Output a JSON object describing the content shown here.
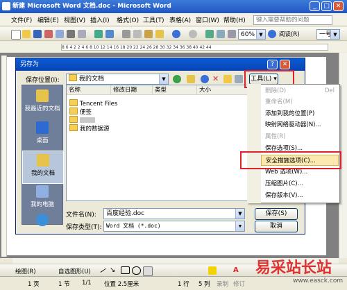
{
  "window": {
    "title": "新建 Microsoft Word 文档.doc - Microsoft Word"
  },
  "menubar": {
    "items": [
      "文件(F)",
      "编辑(E)",
      "视图(V)",
      "插入(I)",
      "格式(O)",
      "工具(T)",
      "表格(A)",
      "窗口(W)",
      "帮助(H)"
    ],
    "help_placeholder": "键入需要帮助的问题"
  },
  "toolbar": {
    "zoom": "60%",
    "read_label": "阅读(R)",
    "style_value": "一号"
  },
  "ruler": {
    "text": "8 6 4 2 2 4 6 8 10 12 14 16 18 20 22 24 26 28 30 32 34 36 38 40 42 44"
  },
  "dialog": {
    "title": "另存为",
    "save_in_label": "保存位置(I):",
    "save_in_value": "我的文档",
    "tools_button": "工具(L)",
    "columns": [
      "名称",
      "修改日期",
      "类型",
      "大小"
    ],
    "files": [
      "Tencent Files",
      "便签",
      "",
      "我的数据源"
    ],
    "places": [
      "我最近的文档",
      "桌面",
      "我的文档",
      "我的电脑",
      ""
    ],
    "filename_label": "文件名(N):",
    "filename_value": "百度经验.doc",
    "filetype_label": "保存类型(T):",
    "filetype_value": "Word 文档 (*.doc)",
    "save_button": "保存(S)",
    "cancel_button": "取消"
  },
  "tools_menu": {
    "items": [
      {
        "label": "删除(D)",
        "shortcut": "Del",
        "disabled": true
      },
      {
        "label": "重命名(M)",
        "shortcut": "",
        "disabled": true
      },
      {
        "label": "添加到我的位置(P)",
        "shortcut": "",
        "disabled": false
      },
      {
        "label": "映射网络驱动器(N)...",
        "shortcut": "",
        "disabled": false
      },
      {
        "label": "属性(R)",
        "shortcut": "",
        "disabled": true
      },
      {
        "label": "保存选项(S)...",
        "shortcut": "",
        "disabled": false
      },
      {
        "label": "安全措施选项(C)...",
        "shortcut": "",
        "disabled": false,
        "highlighted": true
      },
      {
        "label": "Web 选项(W)...",
        "shortcut": "",
        "disabled": false
      },
      {
        "label": "压缩图片(C)...",
        "shortcut": "",
        "disabled": false
      },
      {
        "label": "保存版本(V)...",
        "shortcut": "",
        "disabled": false
      }
    ]
  },
  "drawbar": {
    "draw_label": "绘图(R)",
    "autoshape_label": "自选图形(U)"
  },
  "status": {
    "page": "1 页",
    "section": "1 节",
    "pages": "1/1",
    "position": "位置 2.5厘米",
    "line": "1 行",
    "col": "5 列",
    "rec": "录制",
    "trk": "修订"
  },
  "watermark": {
    "text": "易采站长站",
    "url": "www.easck.com"
  },
  "colors": {
    "accent": "#0b5bd4",
    "highlight_box": "#e0202a",
    "menu_highlight": "#fbe9b0"
  }
}
